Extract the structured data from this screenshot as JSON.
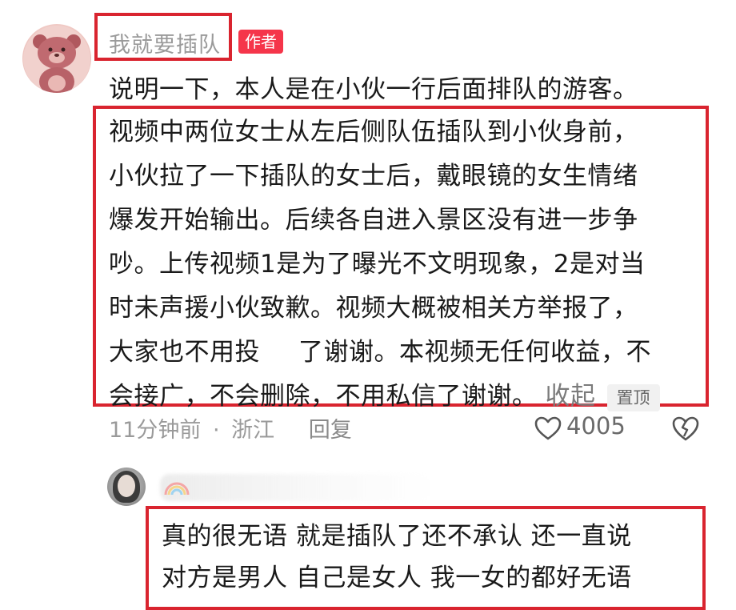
{
  "comment": {
    "username": "我就要插队",
    "author_badge": "作者",
    "lines": [
      "说明一下，本人是在小伙一行后面排队的游客。",
      "视频中两位女士从左后侧队伍插队到小伙身前，",
      "小伙拉了一下插队的女士后，戴眼镜的女生情绪",
      "爆发开始输出。后续各自进入景区没有进一步争",
      "吵。上传视频1是为了曝光不文明现象，2是对当",
      "时未声援小伙致歉。视频大概被相关方举报了，"
    ],
    "line7_a": "大家也不用投",
    "line7_b": "了谢谢。本视频无任何收益，不",
    "line8": "会接广，不会删除，不用私信了谢谢。",
    "collapse_label": "收起",
    "pin_label": "置顶",
    "time": "11分钟前",
    "separator": "·",
    "location": "浙江",
    "reply_label": "回复",
    "like_count": "4005"
  },
  "reply": {
    "lines": [
      "真的很无语 就是插队了还不承认 还一直说",
      "对方是男人 自己是女人 我一女的都好无语"
    ]
  },
  "colors": {
    "highlight_box": "#d9242f",
    "author_badge": "#f5354a",
    "meta_text": "#9a9a9a"
  }
}
